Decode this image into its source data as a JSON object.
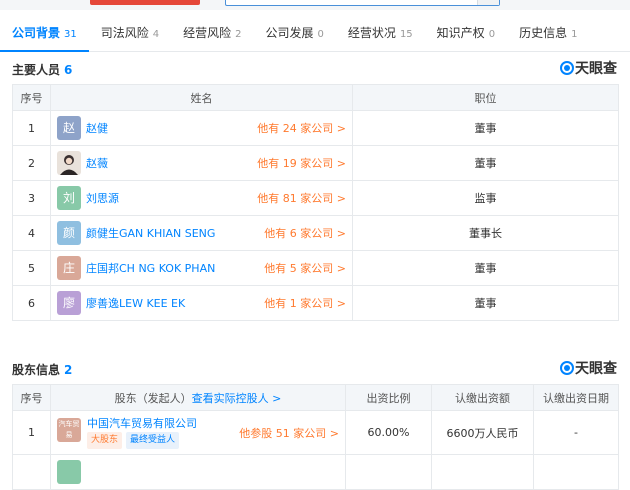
{
  "tabs": [
    {
      "label": "公司背景",
      "count": "31"
    },
    {
      "label": "司法风险",
      "count": "4"
    },
    {
      "label": "经营风险",
      "count": "2"
    },
    {
      "label": "公司发展",
      "count": "0"
    },
    {
      "label": "经营状况",
      "count": "15"
    },
    {
      "label": "知识产权",
      "count": "0"
    },
    {
      "label": "历史信息",
      "count": "1"
    }
  ],
  "brand": "天眼查",
  "personnel": {
    "title": "主要人员",
    "count": "6",
    "headers": {
      "index": "序号",
      "name": "姓名",
      "position": "职位"
    },
    "rows": [
      {
        "index": "1",
        "avatar": "赵",
        "avatar_color": "#8ea3c9",
        "name": "赵健",
        "other": "他有 24 家公司 >",
        "position": "董事"
      },
      {
        "index": "2",
        "avatar": "",
        "avatar_color": "#e9e2db",
        "name": "赵薇",
        "other": "他有 19 家公司 >",
        "position": "董事"
      },
      {
        "index": "3",
        "avatar": "刘",
        "avatar_color": "#88c9a8",
        "name": "刘思源",
        "other": "他有 81 家公司 >",
        "position": "监事"
      },
      {
        "index": "4",
        "avatar": "颜",
        "avatar_color": "#8fbfe0",
        "name": "颜健生GAN KHIAN SENG",
        "other": "他有 6 家公司 >",
        "position": "董事长"
      },
      {
        "index": "5",
        "avatar": "庄",
        "avatar_color": "#d9a898",
        "name": "庄国邦CH NG KOK PHAN",
        "other": "他有 5 家公司 >",
        "position": "董事"
      },
      {
        "index": "6",
        "avatar": "廖",
        "avatar_color": "#b9a0d6",
        "name": "廖善逸LEW KEE EK",
        "other": "他有 1 家公司 >",
        "position": "董事"
      }
    ]
  },
  "shareholders": {
    "title": "股东信息",
    "count": "2",
    "headers": {
      "index": "序号",
      "holder": "股东（发起人）",
      "holder_link": "查看实际控股人 >",
      "ratio": "出资比例",
      "amount": "认缴出资额",
      "date": "认缴出资日期"
    },
    "rows": [
      {
        "index": "1",
        "avatar": "汽车贸易",
        "avatar_color": "#d9a898",
        "name": "中国汽车贸易有限公司",
        "tag1": "大股东",
        "tag2": "最终受益人",
        "other": "他参股 51 家公司 >",
        "ratio": "60.00%",
        "amount": "6600万人民币",
        "date": "-"
      }
    ]
  }
}
